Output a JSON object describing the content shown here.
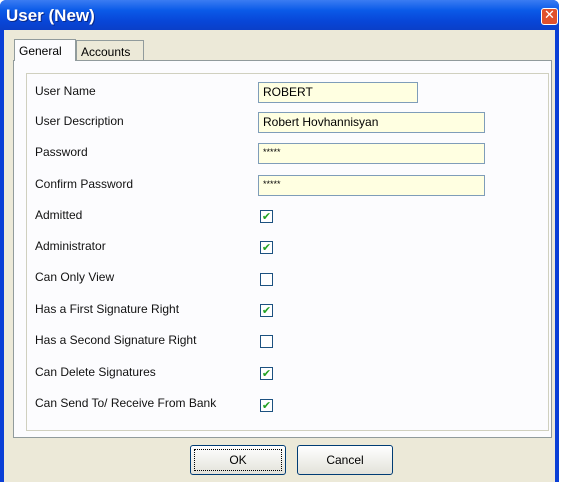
{
  "window": {
    "title": "User (New)"
  },
  "tabs": [
    {
      "label": "General",
      "selected": true
    },
    {
      "label": "Accounts",
      "selected": false
    }
  ],
  "form": {
    "user_name": {
      "label": "User Name",
      "value": "ROBERT"
    },
    "user_description": {
      "label": "User Description",
      "value": "Robert Hovhannisyan"
    },
    "password": {
      "label": "Password",
      "value": "*****"
    },
    "confirm_password": {
      "label": "Confirm Password",
      "value": "*****"
    },
    "checkboxes": [
      {
        "label": "Admitted",
        "checked": true
      },
      {
        "label": "Administrator",
        "checked": true
      },
      {
        "label": "Can Only View",
        "checked": false
      },
      {
        "label": "Has a First Signature Right",
        "checked": true
      },
      {
        "label": "Has a Second Signature Right",
        "checked": false
      },
      {
        "label": "Can Delete Signatures",
        "checked": true
      },
      {
        "label": "Can Send To/ Receive From Bank",
        "checked": true
      }
    ]
  },
  "buttons": {
    "ok": "OK",
    "cancel": "Cancel"
  },
  "icons": {
    "close": "close-icon",
    "check": "checkmark-icon"
  },
  "colors": {
    "titlebar": "#0a5ae8",
    "field_bg": "#ffffe1",
    "check": "#21a121"
  }
}
